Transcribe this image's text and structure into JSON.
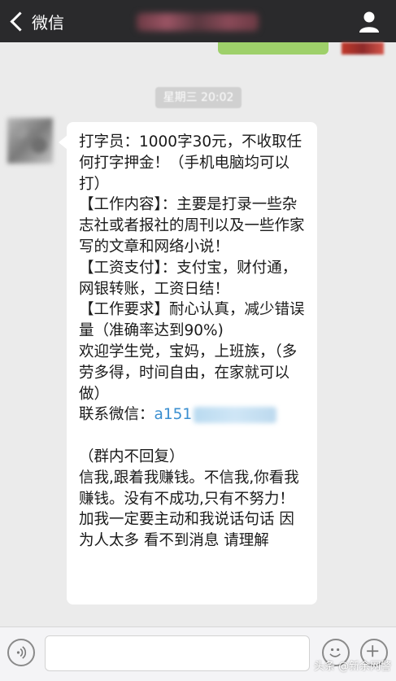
{
  "nav": {
    "back_label": "微信",
    "back_icon": "chevron-left-icon",
    "contact_icon": "person-icon"
  },
  "timestamp": "星期三 20:02",
  "message": {
    "lines": [
      "打字员：1000字30元，不收取任何打字押金！（手机电脑均可以打）",
      "【工作内容】：主要是打录一些杂志社或者报社的周刊以及一些作家写的文章和网络小说！",
      "【工资支付】：支付宝，财付通，网银转账，工资日结！",
      "【工作要求】耐心认真，减少错误量（准确率达到90%)",
      "欢迎学生党，宝妈，上班族，（多劳多得，时间自由，在家就可以做）"
    ],
    "contact_prefix": " 联系微信：",
    "contact_id_visible": "a151",
    "tail_lines": [
      " （群内不回复）",
      " 信我,跟着我赚钱。不信我,你看我赚钱。没有不成功,只有不努力！ 加我一定要主动和我说话句话 因为人太多 看不到消息 请理解"
    ]
  },
  "input_bar": {
    "voice_icon": "voice-icon",
    "emoji_icon": "emoji-icon",
    "plus_icon": "plus-icon"
  },
  "watermark": "头条 @新余网警",
  "colors": {
    "navbar": "#2a2a2c",
    "chat_background": "#ebebeb",
    "outgoing_bubble": "#9ed06a",
    "link": "#3b8fd0"
  }
}
